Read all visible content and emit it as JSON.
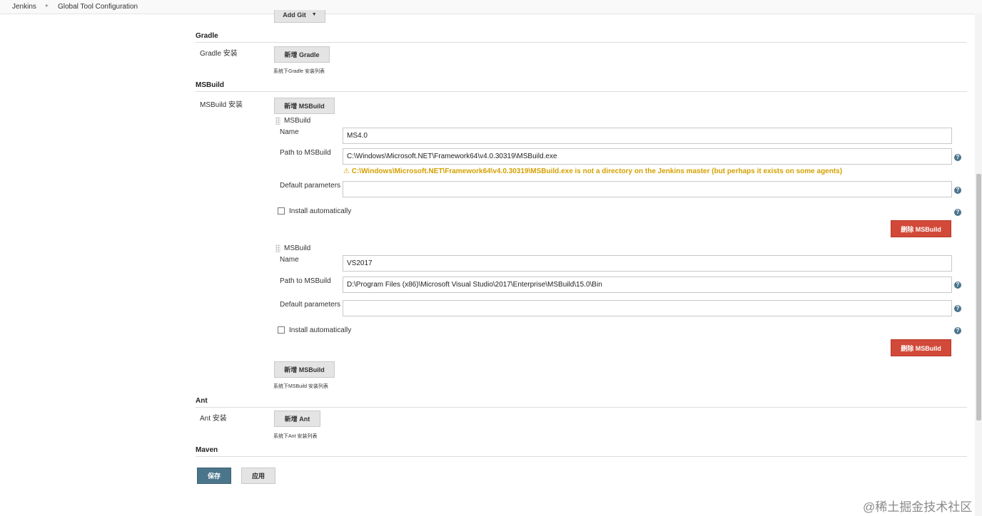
{
  "breadcrumb": [
    "Jenkins",
    "Global Tool Configuration"
  ],
  "add_git_label": "Add Git",
  "gradle": {
    "title": "Gradle",
    "row_label": "Gradle 安装",
    "add_button": "新增 Gradle",
    "description": "系统下Gradle 安装列表"
  },
  "msbuild": {
    "title": "MSBuild",
    "row_label": "MSBuild 安装",
    "add_button": "新增 MSBuild",
    "description": "系统下MSBuild 安装列表",
    "installations": [
      {
        "header": "MSBuild",
        "name_label": "Name",
        "name_value": "MS4.0",
        "path_label": "Path to MSBuild",
        "path_value": "C:\\Windows\\Microsoft.NET\\Framework64\\v4.0.30319\\MSBuild.exe",
        "warning": "C:\\Windows\\Microsoft.NET\\Framework64\\v4.0.30319\\MSBuild.exe is not a directory on the Jenkins master (but perhaps it exists on some agents)",
        "params_label": "Default parameters",
        "params_value": "",
        "install_auto_label": "Install automatically",
        "delete_button": "删除 MSBuild"
      },
      {
        "header": "MSBuild",
        "name_label": "Name",
        "name_value": "VS2017",
        "path_label": "Path to MSBuild",
        "path_value": "D:\\Program Files (x86)\\Microsoft Visual Studio\\2017\\Enterprise\\MSBuild\\15.0\\Bin",
        "params_label": "Default parameters",
        "params_value": "",
        "install_auto_label": "Install automatically",
        "delete_button": "删除 MSBuild"
      }
    ]
  },
  "ant": {
    "title": "Ant",
    "row_label": "Ant 安装",
    "add_button": "新增 Ant",
    "description": "系统下Ant 安装列表"
  },
  "maven": {
    "title": "Maven"
  },
  "footer": {
    "save_button": "保存",
    "apply_button": "应用"
  },
  "watermark": "@稀土掘金技术社区",
  "colors": {
    "delete": "#d24939",
    "save": "#4b758b",
    "warning": "#d4a000"
  }
}
